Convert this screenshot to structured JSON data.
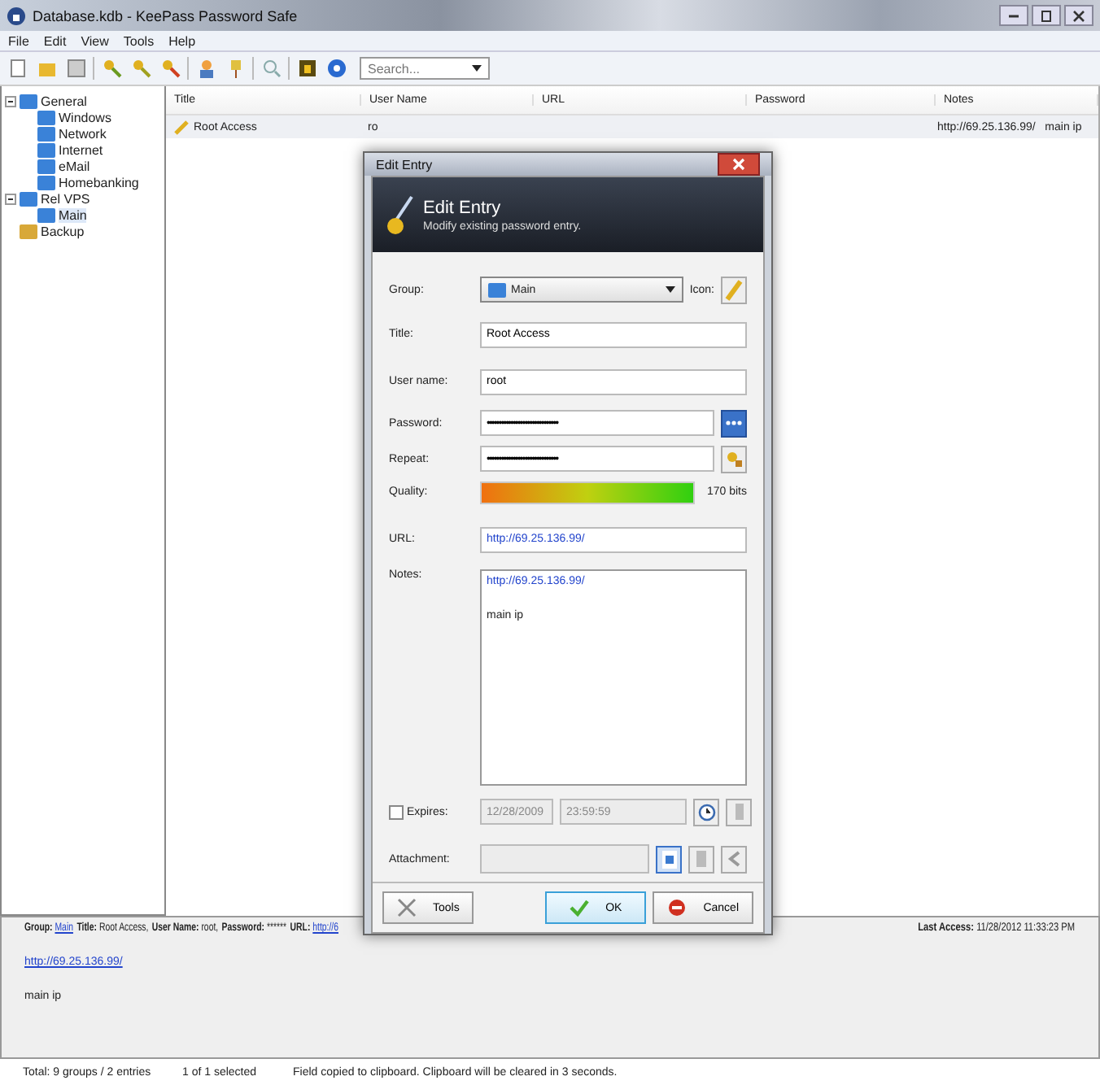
{
  "window": {
    "title": "Database.kdb - KeePass Password Safe"
  },
  "menu": [
    "File",
    "Edit",
    "View",
    "Tools",
    "Help"
  ],
  "search": {
    "placeholder": "Search..."
  },
  "tree": [
    {
      "label": "General",
      "expanded": true,
      "selected": false,
      "children": [
        {
          "label": "Windows",
          "selected": false
        },
        {
          "label": "Network",
          "selected": false
        },
        {
          "label": "Internet",
          "selected": false
        },
        {
          "label": "eMail",
          "selected": false
        },
        {
          "label": "Homebanking",
          "selected": false
        }
      ]
    },
    {
      "label": "Rel VPS",
      "expanded": true,
      "selected": false,
      "children": [
        {
          "label": "Main",
          "selected": true
        }
      ]
    },
    {
      "label": "Backup",
      "selected": false
    }
  ],
  "table": {
    "columns": [
      "Title",
      "User Name",
      "URL",
      "Password",
      "Notes"
    ],
    "rows": [
      {
        "title": "Root Access",
        "user": "ro",
        "notes": "http://69.25.136.99/   main ip",
        "selected": true
      }
    ]
  },
  "details": {
    "left": [
      {
        "label": "Group:",
        "value": "Main",
        "link": true
      },
      {
        "label": "Title:",
        "value": "Root Access,",
        "link": false
      },
      {
        "label": "User Name:",
        "value": "root,",
        "link": false
      },
      {
        "label": "Password:",
        "value": "******",
        "link": false
      },
      {
        "label": "URL:",
        "value": "http://6",
        "link": true
      }
    ],
    "right": [
      {
        "label": "Last Access:",
        "value": "11/28/2012 11:33:23 PM",
        "link": false
      }
    ],
    "url": "http://69.25.136.99/",
    "notes": "main ip"
  },
  "status": [
    "Total: 9 groups / 2 entries",
    "1 of 1 selected",
    "Field copied to clipboard. Clipboard will be cleared in 3 seconds."
  ],
  "dialog": {
    "title": "Edit Entry",
    "heading": "Edit Entry",
    "subtitle": "Modify existing password entry.",
    "group_label": "Group:",
    "group": "Main",
    "icon_label": "Icon:",
    "title_label": "Title:",
    "title_value": "Root Access",
    "user_label": "User name:",
    "user_value": "root",
    "password_label": "Password:",
    "password_value": "••••••••••••••••••••••••••••••",
    "repeat_label": "Repeat:",
    "repeat_value": "••••••••••••••••••••••••••••••",
    "quality_label": "Quality:",
    "quality": {
      "level": 1,
      "reading": "170 bits"
    },
    "url_label": "URL:",
    "url_value": "http://69.25.136.99/",
    "notes_label": "Notes:",
    "notes_link": "http://69.25.136.99/",
    "notes_text": "main ip",
    "expires": {
      "label": "Expires:",
      "checked": false,
      "date": "12/28/2009",
      "time": "23:59:59"
    },
    "attachment_label": "Attachment:",
    "buttons": {
      "tools": "Tools",
      "ok": "OK",
      "cancel": "Cancel"
    }
  }
}
